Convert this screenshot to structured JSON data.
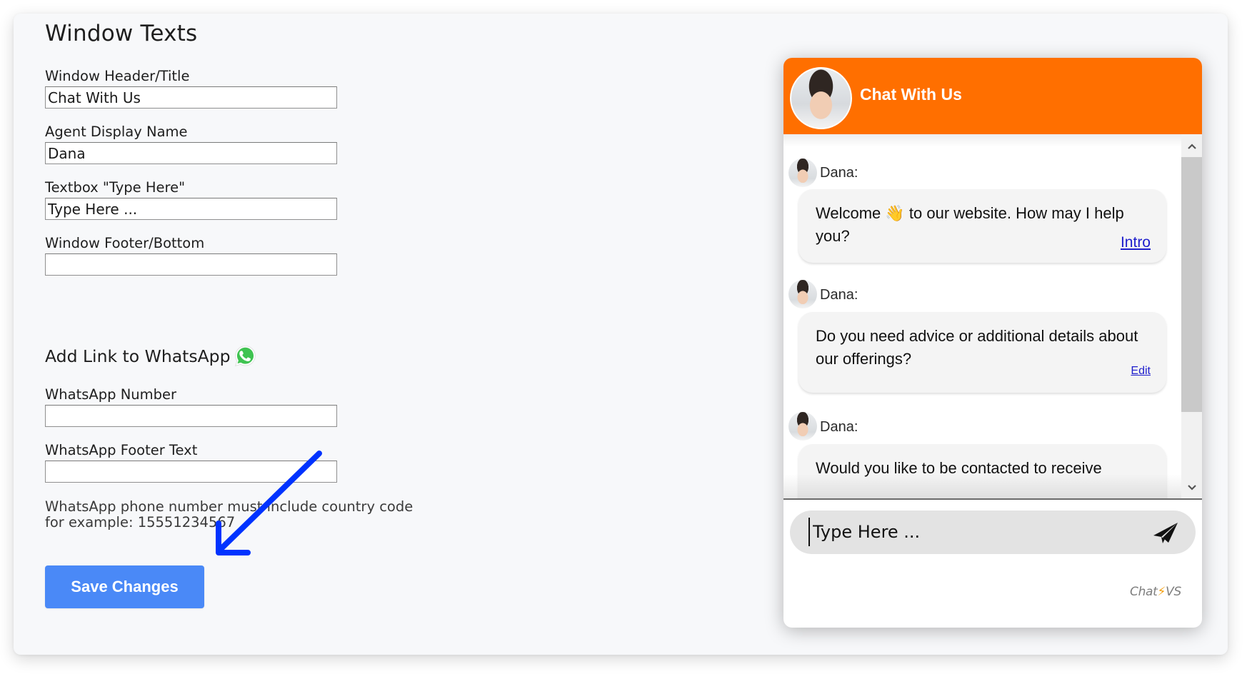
{
  "settings": {
    "section_title": "Window Texts",
    "fields": [
      {
        "label": "Window Header/Title",
        "value": "Chat With Us"
      },
      {
        "label": "Agent Display Name",
        "value": "Dana"
      },
      {
        "label": "Textbox \"Type Here\"",
        "value": "Type Here ..."
      },
      {
        "label": "Window Footer/Bottom",
        "value": ""
      }
    ],
    "whatsapp": {
      "title": "Add Link to WhatsApp",
      "icon": "whatsapp-icon",
      "fields": [
        {
          "label": "WhatsApp Number",
          "value": ""
        },
        {
          "label": "WhatsApp Footer Text",
          "value": ""
        }
      ],
      "help_line1": "WhatsApp phone number must include country code",
      "help_line2": "for example: 15551234567"
    },
    "save_label": "Save Changes",
    "accent_color": "#4a89f7",
    "annotation": {
      "type": "arrow",
      "color": "#0033ff",
      "points_to": "save-button"
    }
  },
  "chat_preview": {
    "header_title": "Chat With Us",
    "header_color": "#ff6f00",
    "messages": [
      {
        "sender": "Dana:",
        "text": "Welcome 👋 to our website. How may I help you?",
        "link": "Intro"
      },
      {
        "sender": "Dana:",
        "text": "Do you need advice or additional details about our offerings?",
        "link": "Edit"
      },
      {
        "sender": "Dana:",
        "text": "Would you like to be contacted to receive"
      }
    ],
    "input_placeholder": "Type Here ...",
    "scroll_up_icon": "chevron-up-icon",
    "scroll_down_icon": "chevron-down-icon",
    "send_icon": "paper-plane-icon",
    "branding_left": "Chat",
    "branding_bolt": "⚡",
    "branding_right": "VS"
  }
}
